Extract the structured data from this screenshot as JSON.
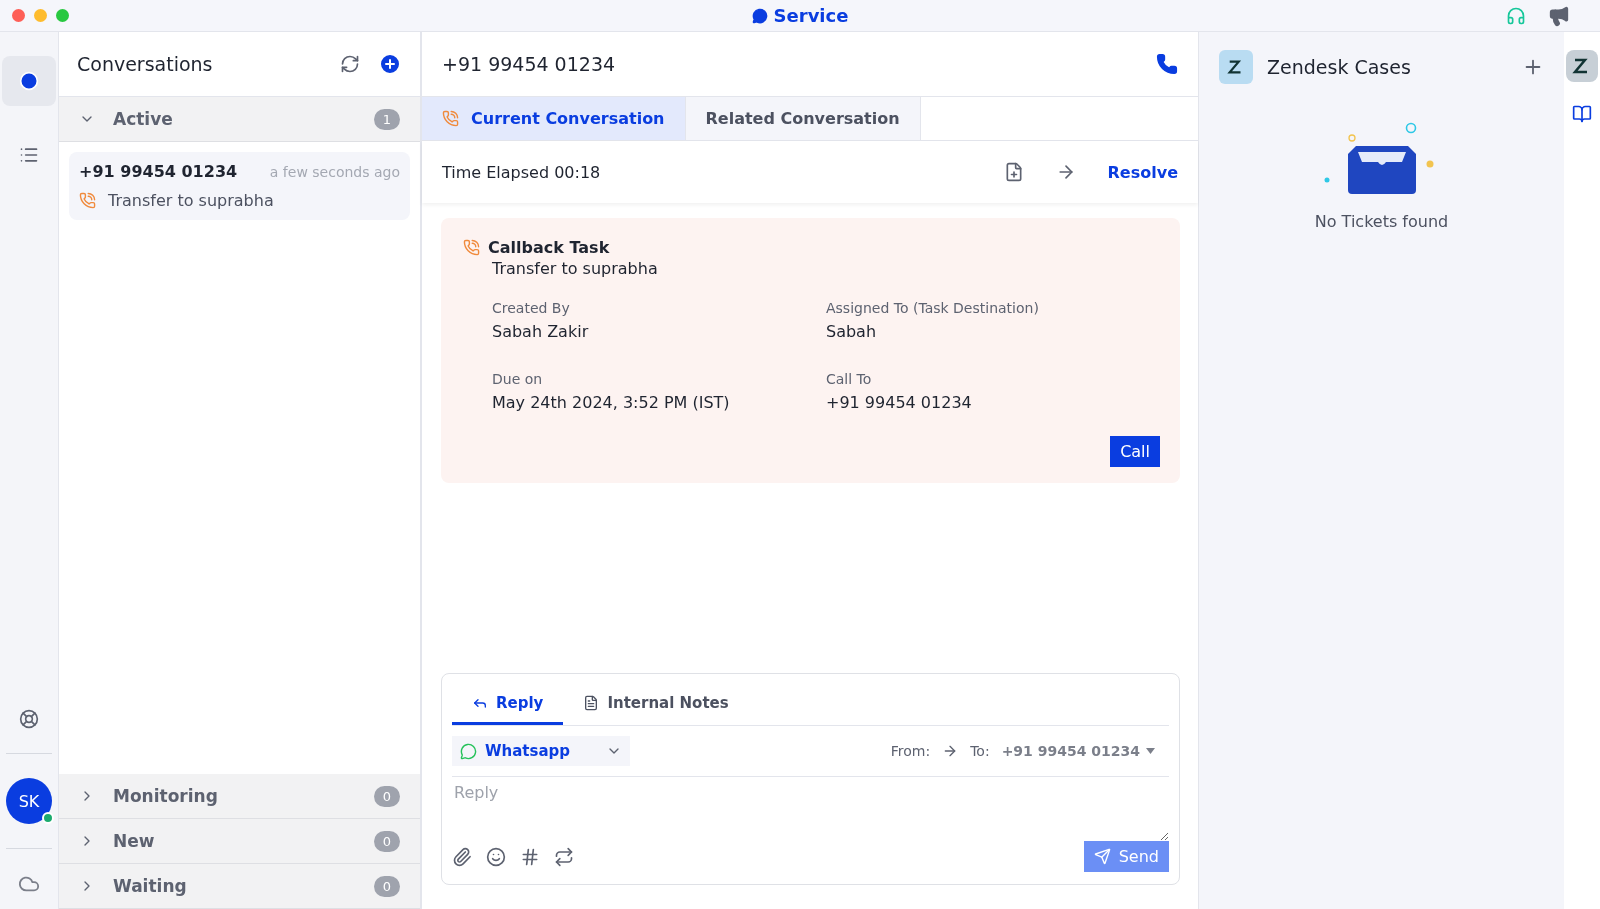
{
  "window": {
    "title": "Service"
  },
  "rail": {
    "avatar": "SK",
    "online": true
  },
  "conversations": {
    "title": "Conversations",
    "groups": [
      {
        "label": "Active",
        "count": "1",
        "expanded": true,
        "items": [
          {
            "phone": "+91 99454 01234",
            "time": "a few seconds ago",
            "subject": "Transfer to suprabha",
            "selected": true
          }
        ]
      },
      {
        "label": "Monitoring",
        "count": "0",
        "expanded": false
      },
      {
        "label": "New",
        "count": "0",
        "expanded": false
      },
      {
        "label": "Waiting",
        "count": "0",
        "expanded": false
      }
    ]
  },
  "conversation": {
    "phone": "+91 99454 01234",
    "tabs": [
      {
        "label": "Current Conversation",
        "selected": true
      },
      {
        "label": "Related Conversation",
        "selected": false
      }
    ],
    "elapsed": "Time Elapsed 00:18",
    "resolve": "Resolve",
    "task": {
      "title": "Callback Task",
      "subtitle": "Transfer to suprabha",
      "fields": [
        {
          "label": "Created By",
          "value": "Sabah Zakir"
        },
        {
          "label": "Assigned To (Task Destination)",
          "value": "Sabah"
        },
        {
          "label": "Due on",
          "value": "May 24th 2024, 3:52 PM (IST)"
        },
        {
          "label": "Call To",
          "value": "+91 99454 01234"
        }
      ],
      "action": "Call"
    },
    "composer": {
      "tabs": [
        {
          "label": "Reply",
          "selected": true
        },
        {
          "label": "Internal Notes",
          "selected": false
        }
      ],
      "channel": "Whatsapp",
      "from": "From:",
      "to": "To:",
      "to_value": "+91 99454 01234",
      "placeholder": "Reply",
      "send": "Send"
    }
  },
  "cases": {
    "title": "Zendesk Cases",
    "empty": "No Tickets found"
  }
}
